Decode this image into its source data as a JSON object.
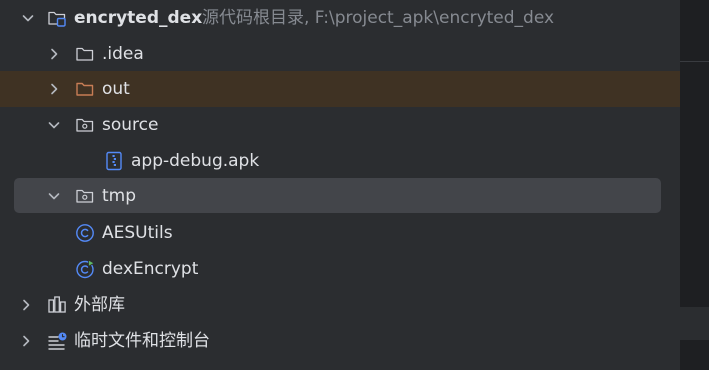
{
  "tree": {
    "root": {
      "label": "encryted_dex",
      "hint": "源代码根目录, F:\\project_apk\\encryted_dex"
    },
    "items": [
      {
        "label": ".idea",
        "icon": "folder-icon",
        "expanded": false
      },
      {
        "label": "out",
        "icon": "folder-excluded-icon",
        "expanded": false
      },
      {
        "label": "source",
        "icon": "folder-source-icon",
        "expanded": true
      },
      {
        "label": "app-debug.apk",
        "icon": "apk-file-icon"
      },
      {
        "label": "tmp",
        "icon": "folder-source-icon",
        "expanded": true
      },
      {
        "label": "AESUtils",
        "icon": "java-class-icon"
      },
      {
        "label": "dexEncrypt",
        "icon": "java-main-class-icon"
      },
      {
        "label": "外部库",
        "icon": "library-icon",
        "expanded": false
      },
      {
        "label": "临时文件和控制台",
        "icon": "scratches-icon",
        "expanded": false
      }
    ]
  },
  "colors": {
    "background": "#2b2d30",
    "selected_row": "#43454a",
    "excluded_highlight": "#3f3223",
    "excluded_folder": "#c77d55",
    "class_icon": "#548af7",
    "run_badge": "#5fb865",
    "text": "#dfe1e5",
    "hint_text": "#868a91"
  }
}
